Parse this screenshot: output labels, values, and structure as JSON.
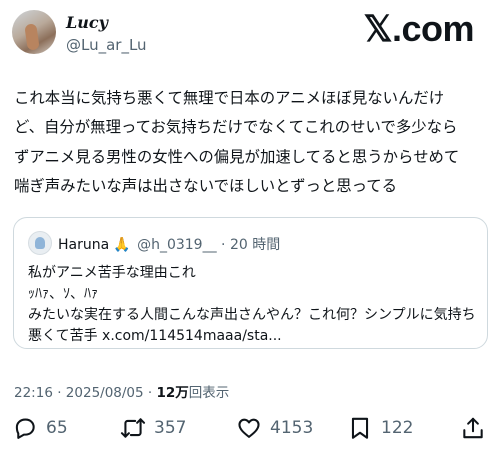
{
  "brand": {
    "logo_text": "𝕏.com"
  },
  "author": {
    "display_name": "Lucy",
    "handle": "@Lu_ar_Lu"
  },
  "tweet": {
    "text": "これ本当に気持ち悪くて無理で日本のアニメほぼ見ないんだけ\nど、自分が無理ってお気持ちだけでなくてこれのせいで多少なら\nずアニメ見る男性の女性への偏見が加速してると思うからせめて\n喘ぎ声みたいな声は出さないでほしいとずっと思ってる"
  },
  "quoted": {
    "name": "Haruna",
    "emoji": "🙏",
    "handle": "@h_0319__",
    "dot": "·",
    "time": "20 時間",
    "text": "私がアニメ苦手な理由これ\nｯﾊｧ、ｿ、ﾊｧ\nみたいな実在する人間こんな声出さんやん？これ何？シンプルに気持ち\n悪くて苦手 x.com/114514maaa/sta..."
  },
  "meta": {
    "time": "22:16",
    "dot": "·",
    "date": "2025/08/05",
    "views_count": "12万",
    "views_label": "回表示"
  },
  "actions": {
    "replies": "65",
    "reposts": "357",
    "likes": "4153",
    "bookmarks": "122"
  },
  "colors": {
    "text": "#0f1419",
    "secondary": "#536471",
    "border": "#cfd9de"
  }
}
